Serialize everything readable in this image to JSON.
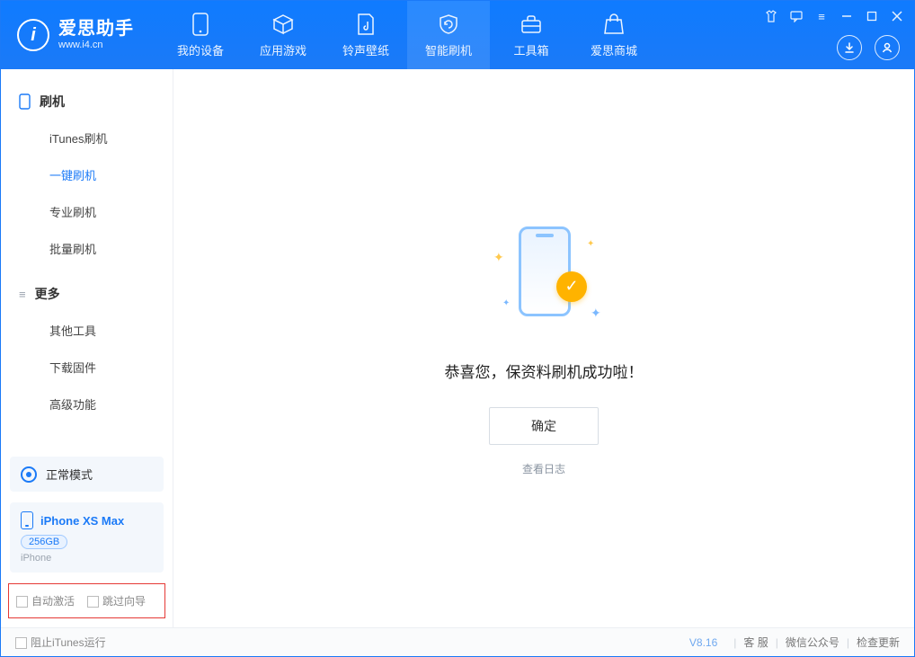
{
  "app": {
    "name": "爱思助手",
    "url": "www.i4.cn"
  },
  "nav": {
    "my_device": "我的设备",
    "app_games": "应用游戏",
    "ring_wall": "铃声壁纸",
    "smart_flash": "智能刷机",
    "toolbox": "工具箱",
    "store": "爱思商城"
  },
  "sidebar": {
    "section_flash": "刷机",
    "items_flash": {
      "itunes_flash": "iTunes刷机",
      "onekey_flash": "一键刷机",
      "pro_flash": "专业刷机",
      "batch_flash": "批量刷机"
    },
    "section_more": "更多",
    "items_more": {
      "other_tools": "其他工具",
      "download_fw": "下载固件",
      "adv_func": "高级功能"
    }
  },
  "mode": {
    "label": "正常模式"
  },
  "device": {
    "name": "iPhone XS Max",
    "capacity": "256GB",
    "type": "iPhone"
  },
  "options": {
    "auto_activate": "自动激活",
    "skip_guide": "跳过向导"
  },
  "main": {
    "success": "恭喜您，保资料刷机成功啦！",
    "ok": "确定",
    "view_log": "查看日志"
  },
  "status": {
    "block_itunes": "阻止iTunes运行",
    "version": "V8.16",
    "support": "客 服",
    "wechat": "微信公众号",
    "update": "检查更新"
  }
}
